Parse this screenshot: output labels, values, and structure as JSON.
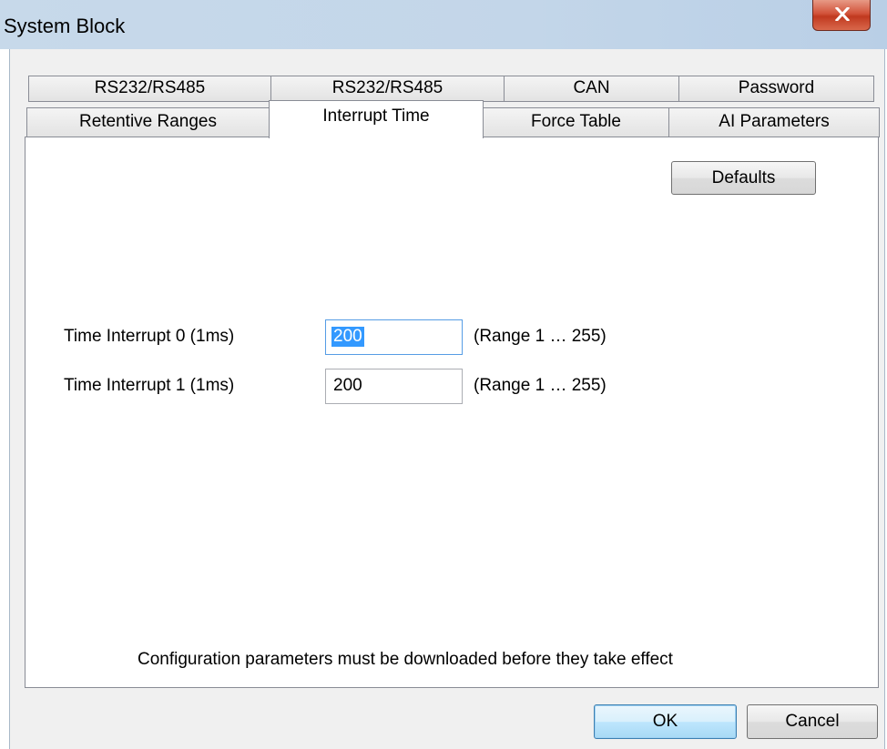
{
  "window": {
    "title": "System Block"
  },
  "tabs": {
    "row1": [
      {
        "label": "RS232/RS485"
      },
      {
        "label": "RS232/RS485"
      },
      {
        "label": "CAN"
      },
      {
        "label": "Password"
      }
    ],
    "row2": [
      {
        "label": "Retentive Ranges"
      },
      {
        "label": "Interrupt Time",
        "active": true
      },
      {
        "label": "Force Table"
      },
      {
        "label": "AI Parameters"
      }
    ]
  },
  "panel": {
    "defaults_label": "Defaults",
    "fields": [
      {
        "label": "Time Interrupt 0 (1ms)",
        "value": "200",
        "range": "(Range 1 … 255)",
        "selected": true
      },
      {
        "label": "Time Interrupt 1 (1ms)",
        "value": "200",
        "range": "(Range 1 … 255)",
        "selected": false
      }
    ],
    "note": "Configuration parameters must be downloaded before they take effect"
  },
  "footer": {
    "ok_label": "OK",
    "cancel_label": "Cancel"
  }
}
